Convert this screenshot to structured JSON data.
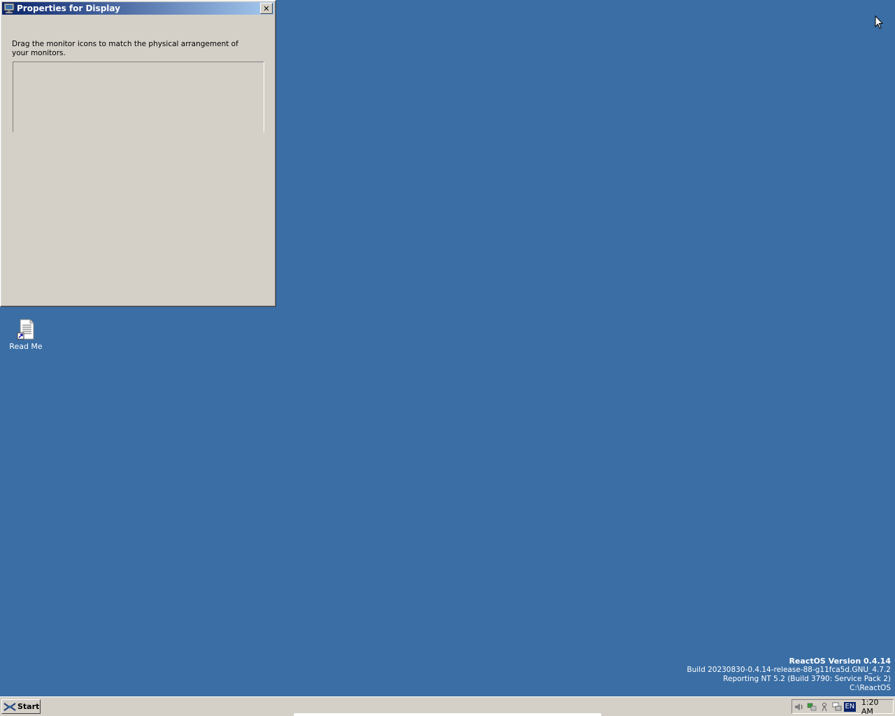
{
  "window": {
    "title": "Properties for Display",
    "close_label": "✕",
    "instruction": "Drag the monitor icons to match the physical arrangement of your monitors."
  },
  "desktop": {
    "icons": [
      {
        "label": "Read Me",
        "icon": "text-file-shortcut-icon"
      }
    ]
  },
  "version_info": {
    "title": "ReactOS Version 0.4.14",
    "build": "Build 20230830-0.4.14-release-88-g11fca5d.GNU_4.7.2",
    "reporting": "Reporting NT 5.2 (Build 3790: Service Pack 2)",
    "path": "C:\\ReactOS"
  },
  "taskbar": {
    "start_label": "Start",
    "tray_icons": [
      "volume-icon",
      "network-icon",
      "usb-device-icon",
      "display-icon"
    ],
    "language": "EN",
    "clock": "1:20 AM"
  },
  "colors": {
    "desktop_bg": "#3a6ea5",
    "title_gradient_start": "#0a246a",
    "title_gradient_end": "#a6caf0",
    "window_face": "#d4d0c8"
  }
}
